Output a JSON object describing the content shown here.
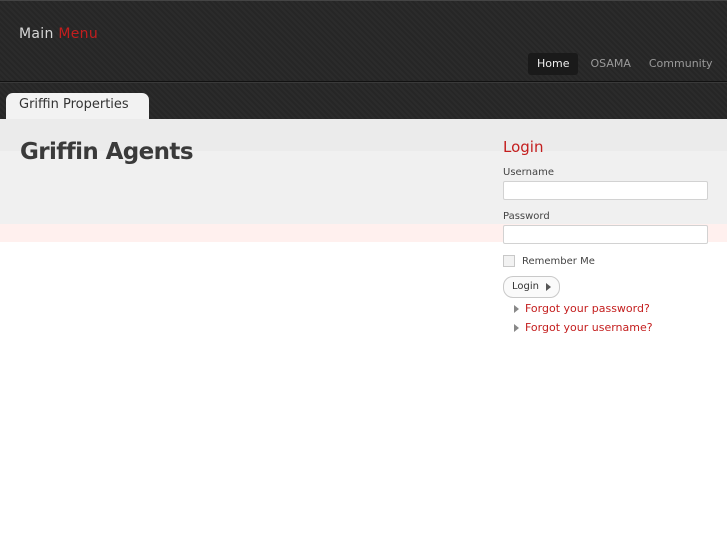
{
  "header": {
    "title_part1": "Main",
    "title_part2": "Menu",
    "nav": [
      {
        "label": "Home",
        "active": true
      },
      {
        "label": "OSAMA",
        "active": false
      },
      {
        "label": "Community",
        "active": false
      }
    ]
  },
  "tab": {
    "label": "Griffin Properties"
  },
  "main": {
    "title": "Griffin Agents"
  },
  "login": {
    "heading": "Login",
    "username_label": "Username",
    "username_value": "",
    "password_label": "Password",
    "password_value": "",
    "remember_label": "Remember Me",
    "remember_checked": false,
    "button_label": "Login",
    "links": [
      {
        "label": "Forgot your password?"
      },
      {
        "label": "Forgot your username?"
      }
    ]
  },
  "colors": {
    "accent": "#c41e1e",
    "header_bg": "#2b2b2b",
    "band_bg": "#f0f0f0",
    "strip_bg": "#fff0ee"
  }
}
